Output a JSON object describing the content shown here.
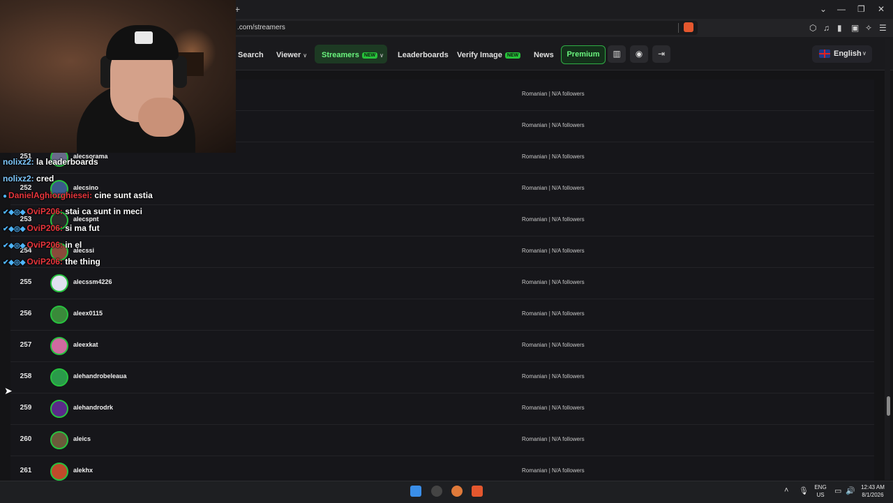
{
  "browser": {
    "url": ".com/streamers",
    "new_tab_glyph": "+",
    "window_controls": [
      "⌄",
      "—",
      "❐",
      "✕"
    ]
  },
  "nav": {
    "search": "Search",
    "viewer": "Viewer",
    "streamers": "Streamers",
    "streamers_badge": "NEW",
    "leaderboards": "Leaderboards",
    "verify_image": "Verify Image",
    "verify_badge": "NEW",
    "news": "News",
    "premium": "Premium",
    "language": "English",
    "icons": [
      "stats-icon",
      "discord-icon",
      "login-icon"
    ]
  },
  "list": {
    "top_rows": [
      {
        "info": "Romanian | N/A followers"
      },
      {
        "info": "Romanian | N/A followers"
      }
    ],
    "rows": [
      {
        "rank": "251",
        "name": "alecsorama",
        "info": "Romanian | N/A followers",
        "avatar_color": "#6a6a8a"
      },
      {
        "rank": "252",
        "name": "alecsino",
        "info": "Romanian | N/A followers",
        "avatar_color": "#3a5a8a"
      },
      {
        "rank": "253",
        "name": "alecspnt",
        "info": "Romanian | N/A followers",
        "avatar_color": "#2a2a2a"
      },
      {
        "rank": "254",
        "name": "alecssi",
        "info": "Romanian | N/A followers",
        "avatar_color": "#8a4a3a"
      },
      {
        "rank": "255",
        "name": "alecssm4226",
        "info": "Romanian | N/A followers",
        "avatar_color": "#e0e0f0"
      },
      {
        "rank": "256",
        "name": "aleex0115",
        "info": "Romanian | N/A followers",
        "avatar_color": "#3a8a3a"
      },
      {
        "rank": "257",
        "name": "aleexkat",
        "info": "Romanian | N/A followers",
        "avatar_color": "#d06aa0"
      },
      {
        "rank": "258",
        "name": "alehandrobeleaua",
        "info": "Romanian | N/A followers",
        "avatar_color": "#2a9a4a"
      },
      {
        "rank": "259",
        "name": "alehandrodrk",
        "info": "Romanian | N/A followers",
        "avatar_color": "#5a2a8a"
      },
      {
        "rank": "260",
        "name": "aleics",
        "info": "Romanian | N/A followers",
        "avatar_color": "#6a5a3a"
      },
      {
        "rank": "261",
        "name": "alekhx",
        "info": "Romanian | N/A followers",
        "avatar_color": "#c04a2a"
      }
    ]
  },
  "chat": [
    {
      "user": "nolixz2:",
      "msg": "la leaderboards",
      "style": "u1"
    },
    {
      "user": "nolixz2:",
      "msg": "cred",
      "style": "u1"
    },
    {
      "user": "DanielAghiorghiesei:",
      "msg": "cine sunt astia",
      "style": "u2"
    },
    {
      "user": "OviP206:",
      "msg": "stai ca sunt in meci",
      "style": "u2"
    },
    {
      "user": "OviP206:",
      "msg": "si ma fut",
      "style": "u2"
    },
    {
      "user": "OviP206:",
      "msg": "in el",
      "style": "u2"
    },
    {
      "user": "OviP206:",
      "msg": "the thing",
      "style": "u2"
    }
  ],
  "taskbar": {
    "lang_top": "ENG",
    "lang_bottom": "US",
    "time": "12:43 AM",
    "date": "8/1/2026"
  }
}
